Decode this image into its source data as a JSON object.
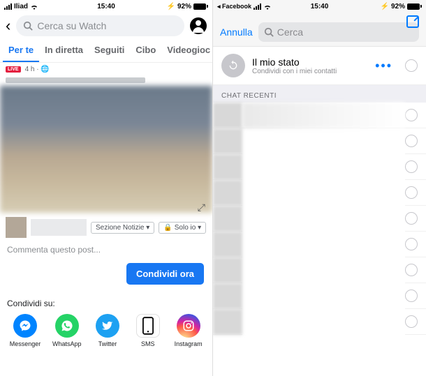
{
  "left": {
    "status": {
      "carrier": "Iliad",
      "wifi": true,
      "time": "15:40",
      "battery_pct": "92%"
    },
    "header": {
      "search_placeholder": "Cerca su Watch"
    },
    "tabs": [
      "Per te",
      "In diretta",
      "Seguiti",
      "Cibo",
      "Videogioc"
    ],
    "active_tab": 0,
    "post": {
      "live_label": "LIVE",
      "time_text": "4 h · 🌐",
      "section_chip": "Sezione Notizie ▾",
      "privacy_chip": "Solo io ▾",
      "comment_placeholder": "Commenta questo post...",
      "share_button": "Condividi ora"
    },
    "share": {
      "label": "Condividi su:",
      "apps": [
        {
          "name": "Messenger",
          "icon": "messenger"
        },
        {
          "name": "WhatsApp",
          "icon": "whatsapp"
        },
        {
          "name": "Twitter",
          "icon": "twitter"
        },
        {
          "name": "SMS",
          "icon": "sms"
        },
        {
          "name": "Instagram",
          "icon": "instagram"
        }
      ]
    }
  },
  "right": {
    "status": {
      "back_app": "◂ Facebook",
      "wifi": true,
      "time": "15:40",
      "battery_pct": "92%"
    },
    "modal": {
      "cancel": "Annulla",
      "search_placeholder": "Cerca"
    },
    "my_status": {
      "title": "Il mio stato",
      "subtitle": "Condividi con i miei contatti"
    },
    "recent_label": "CHAT RECENTI",
    "recent_count": 9
  }
}
